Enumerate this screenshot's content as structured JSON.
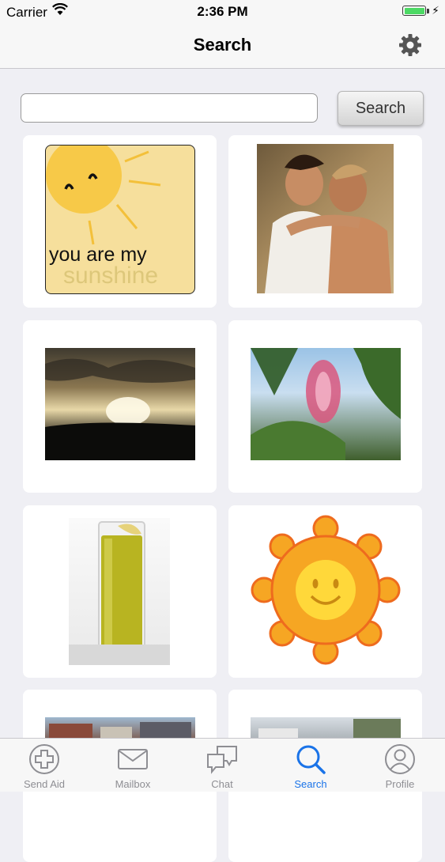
{
  "status_bar": {
    "carrier": "Carrier",
    "time": "2:36 PM"
  },
  "nav": {
    "title": "Search"
  },
  "search": {
    "value": "",
    "button_label": "Search"
  },
  "results": [
    {
      "caption_line1": "you are my",
      "caption_line2": "sunshine"
    },
    {},
    {},
    {},
    {},
    {},
    {},
    {}
  ],
  "tabs": [
    {
      "label": "Send Aid",
      "icon": "plus-circle-icon"
    },
    {
      "label": "Mailbox",
      "icon": "envelope-icon"
    },
    {
      "label": "Chat",
      "icon": "chat-bubbles-icon"
    },
    {
      "label": "Search",
      "icon": "magnifier-icon",
      "active": true
    },
    {
      "label": "Profile",
      "icon": "person-circle-icon"
    }
  ],
  "colors": {
    "accent": "#1a73e8",
    "battery": "#4cd964",
    "background": "#efeff4"
  }
}
